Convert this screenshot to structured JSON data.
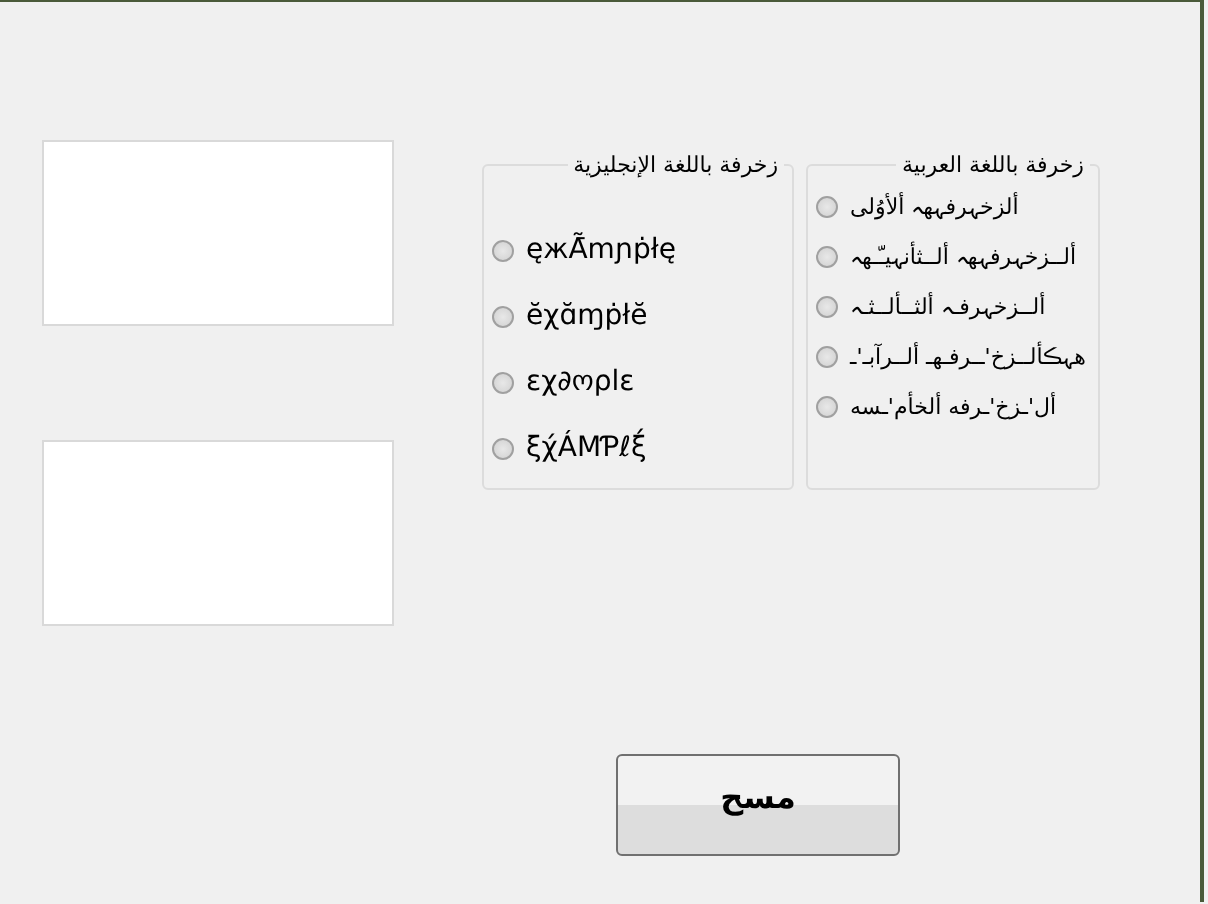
{
  "text_boxes": [
    {
      "kind": "multiline"
    },
    {
      "kind": "multiline"
    }
  ],
  "groups": [
    {
      "title": "زخرفة باللغة العربية",
      "options": [
        {
          "label": "ألزخہرفہهہ ألأوُلى",
          "selected": false
        },
        {
          "label": "ألــزخہرفہهہ ألــثأنہيـّـهہ",
          "selected": false
        },
        {
          "label": "ألــزخہرفـہ ألثــألــثـہ",
          "selected": false
        },
        {
          "label": "هہڪألــزخ'ــرفـهـ ألــرآبـ'ـ",
          "selected": false
        },
        {
          "label": "أل'ـزخ'ـرفه ألخأم'ـسه",
          "selected": false
        }
      ]
    },
    {
      "title": "زخرفة باللغة الإنجليزية",
      "options": [
        {
          "label": "ęжÃ̄mɲṗłę",
          "selected": false
        },
        {
          "label": "ĕχɑ̆ɱṗłĕ",
          "selected": false
        },
        {
          "label": "εχ∂ოρlε",
          "selected": false
        },
        {
          "label": "ξχ́ÁMƤℓξ́",
          "selected": false
        }
      ]
    }
  ],
  "clear_button": {
    "label": "مسح"
  }
}
